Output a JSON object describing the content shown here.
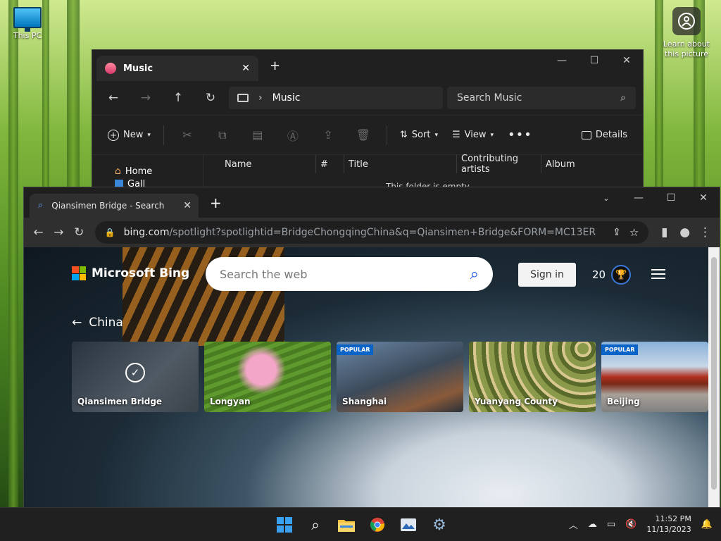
{
  "desktop": {
    "this_pc_label": "This PC",
    "learn_label": "Learn about this picture"
  },
  "explorer": {
    "tab_title": "Music",
    "address_segment": "Music",
    "search_placeholder": "Search Music",
    "toolbar": {
      "new_label": "New",
      "sort_label": "Sort",
      "view_label": "View",
      "details_label": "Details"
    },
    "sidebar": {
      "home_label": "Home",
      "gallery_label": "Gall"
    },
    "columns": [
      "Name",
      "#",
      "Title",
      "Contributing artists",
      "Album"
    ],
    "empty_text": "This folder is empty."
  },
  "chrome": {
    "tab_title": "Qiansimen Bridge - Search",
    "url_domain": "bing.com",
    "url_rest": "/spotlight?spotlightid=BridgeChongqingChina&q=Qiansimen+Bridge&FORM=MC13ER"
  },
  "bing": {
    "logo_text": "Microsoft Bing",
    "search_placeholder": "Search the web",
    "signin_label": "Sign in",
    "points": "20",
    "back_label": "China",
    "cards": [
      {
        "label": "Qiansimen Bridge",
        "badge": "",
        "selected": true
      },
      {
        "label": "Longyan",
        "badge": ""
      },
      {
        "label": "Shanghai",
        "badge": "POPULAR"
      },
      {
        "label": "Yuanyang County",
        "badge": ""
      },
      {
        "label": "Beijing",
        "badge": "POPULAR"
      }
    ]
  },
  "taskbar": {
    "time": "11:52 PM",
    "date": "11/13/2023"
  },
  "colors": {
    "bing_blue": "#0a64c8",
    "dark_window": "#202020",
    "chrome_toolbar": "#2f2f2f"
  }
}
